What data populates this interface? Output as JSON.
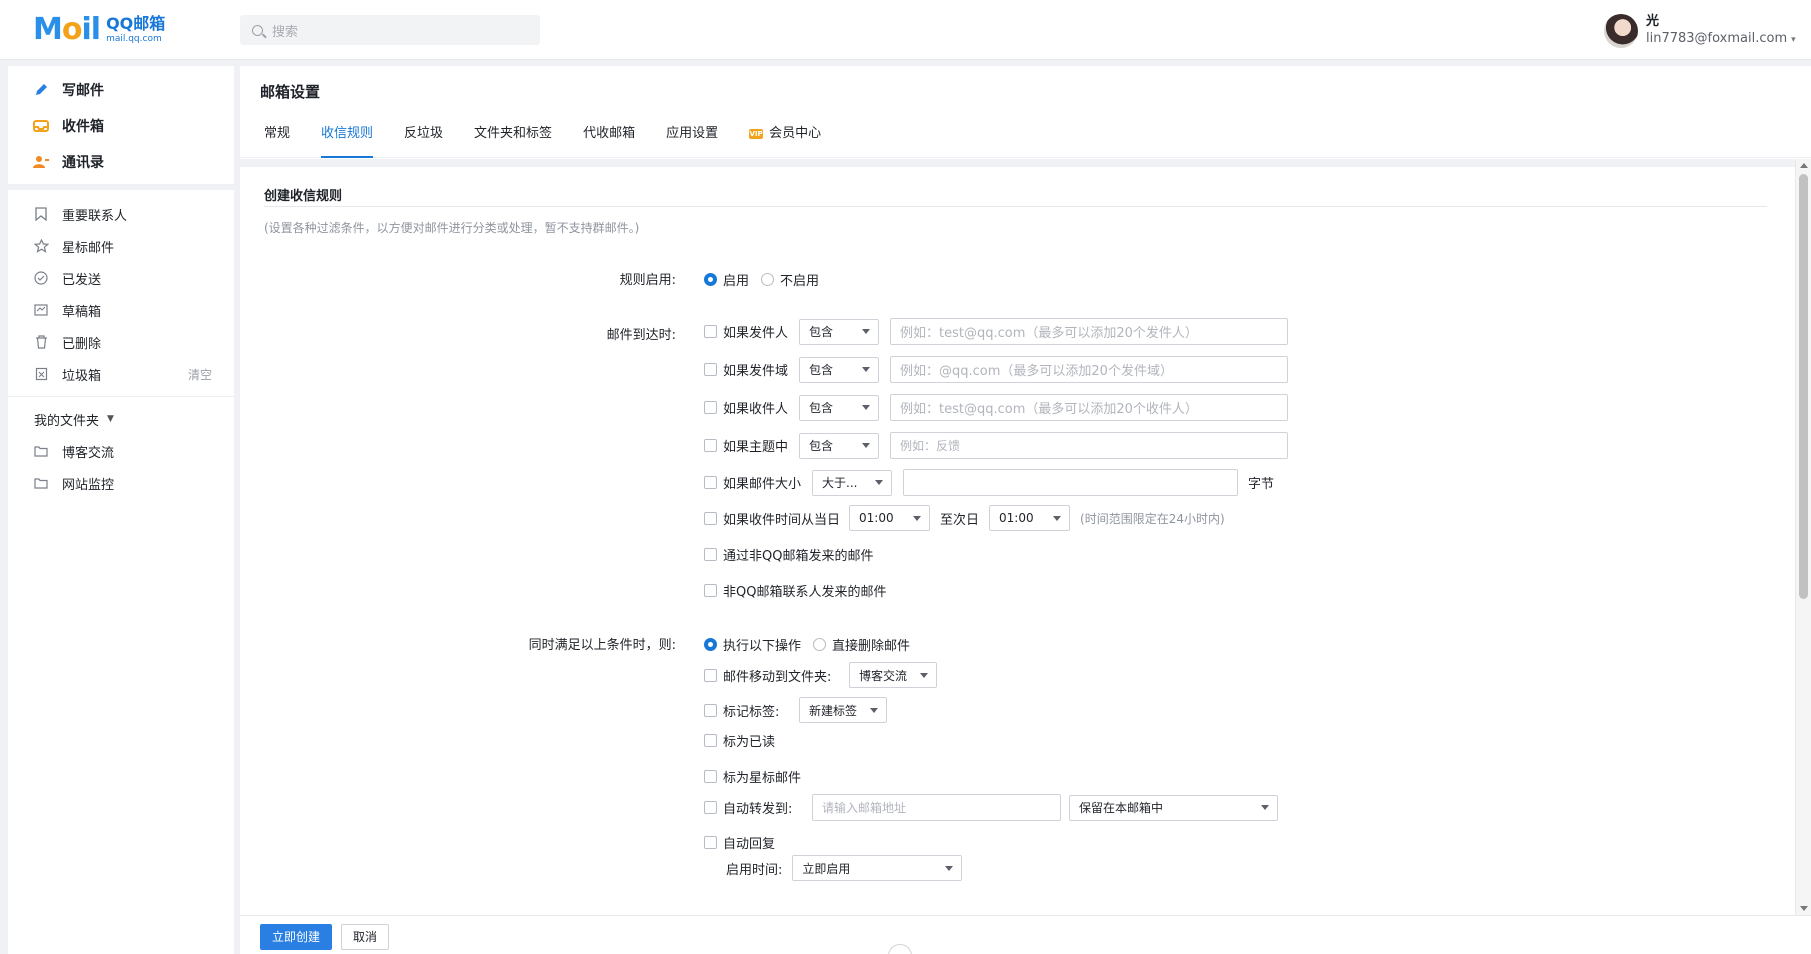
{
  "header": {
    "logo_text": "M",
    "logo_brand": "QQ邮箱",
    "logo_domain": "mail.qq.com",
    "search_placeholder": "搜索",
    "user_name": "光",
    "user_email": "lin7783@foxmail.com"
  },
  "sidebar": {
    "primary": [
      {
        "label": "写邮件",
        "icon": "pencil-icon"
      },
      {
        "label": "收件箱",
        "icon": "inbox-icon"
      },
      {
        "label": "通讯录",
        "icon": "contacts-icon"
      }
    ],
    "folders": [
      {
        "label": "重要联系人",
        "icon": "bookmark-icon"
      },
      {
        "label": "星标邮件",
        "icon": "star-icon"
      },
      {
        "label": "已发送",
        "icon": "check-circle-icon"
      },
      {
        "label": "草稿箱",
        "icon": "draft-icon"
      },
      {
        "label": "已删除",
        "icon": "trash-icon"
      },
      {
        "label": "垃圾箱",
        "icon": "spam-icon"
      }
    ],
    "spam_clear": "清空",
    "my_folders_label": "我的文件夹",
    "my_folders": [
      {
        "label": "博客交流",
        "icon": "folder-icon"
      },
      {
        "label": "网站监控",
        "icon": "folder-icon"
      }
    ]
  },
  "main": {
    "title": "邮箱设置",
    "tabs": [
      "常规",
      "收信规则",
      "反垃圾",
      "文件夹和标签",
      "代收邮箱",
      "应用设置",
      "会员中心"
    ],
    "active_tab": "收信规则",
    "vip_badge": "VIP"
  },
  "form": {
    "section_title": "创建收信规则",
    "section_desc": "(设置各种过滤条件，以方便对邮件进行分类或处理，暂不支持群邮件。)",
    "rule_enable_label": "规则启用:",
    "enable_on": "启用",
    "enable_off": "不启用",
    "arrival_label": "邮件到达时:",
    "cond_sender": "如果发件人",
    "cond_sender_domain": "如果发件域",
    "cond_recipient": "如果收件人",
    "cond_subject": "如果主题中",
    "cond_size": "如果邮件大小",
    "cond_time": "如果收件时间从当日",
    "cond_non_qq": "通过非QQ邮箱发来的邮件",
    "cond_non_contact": "非QQ邮箱联系人发来的邮件",
    "op_contains": "包含",
    "op_greater": "大于...",
    "ph_sender": "例如：test@qq.com（最多可以添加20个发件人）",
    "ph_domain": "例如：@qq.com（最多可以添加20个发件域）",
    "ph_recipient": "例如：test@qq.com（最多可以添加20个收件人）",
    "ph_subject": "例如：反馈",
    "size_unit": "字节",
    "time_from": "01:00",
    "time_to_label": "至次日",
    "time_to": "01:00",
    "time_hint": "(时间范围限定在24小时内)",
    "then_label": "同时满足以上条件时，则:",
    "do_actions": "执行以下操作",
    "delete_direct": "直接删除邮件",
    "act_move": "邮件移动到文件夹:",
    "act_move_value": "博客交流",
    "act_tag": "标记标签:",
    "act_tag_value": "新建标签",
    "act_read": "标为已读",
    "act_star": "标为星标邮件",
    "act_forward": "自动转发到:",
    "act_forward_ph": "请输入邮箱地址",
    "act_forward_keep": "保留在本邮箱中",
    "act_reply": "自动回复",
    "act_time_label": "启用时间:",
    "act_time_value": "立即启用"
  },
  "actions": {
    "create": "立即创建",
    "cancel": "取消"
  }
}
